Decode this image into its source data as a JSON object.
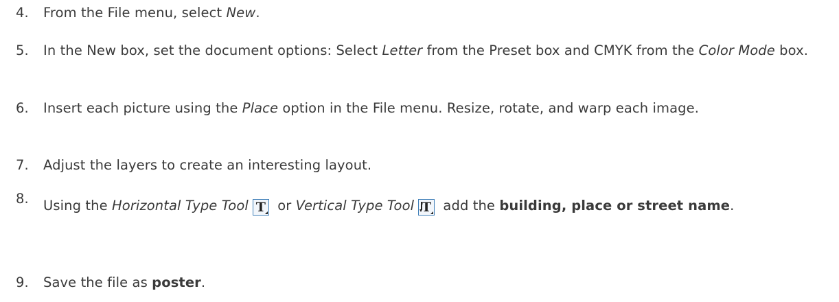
{
  "steps": [
    {
      "number": "4.",
      "parts": {
        "p1": "From the File menu, select ",
        "p2": "New",
        "p3": "."
      }
    },
    {
      "number": "5.",
      "parts": {
        "p1": "In the New box, set the document options: Select ",
        "p2": "Letter",
        "p3": " from the Preset box and CMYK from the ",
        "p4": "Color Mode",
        "p5": " box."
      }
    },
    {
      "number": "6.",
      "parts": {
        "p1": "Insert each picture using the ",
        "p2": "Place",
        "p3": " option in the File menu. Resize, rotate, and warp each image."
      }
    },
    {
      "number": "7.",
      "parts": {
        "p1": "Adjust the layers to create an interesting layout."
      }
    },
    {
      "number": "8.",
      "parts": {
        "p1": "Using the ",
        "p2": "Horizontal Type Tool",
        "p3": " or ",
        "p4": "Vertical Type Tool",
        "p5": " add the ",
        "p6": "building, place or street name",
        "p7": "."
      },
      "icons": {
        "horizontal_type_tool": {
          "glyph": "T",
          "icon": "horizontal-type-tool-icon"
        },
        "vertical_type_tool": {
          "glyph": "T",
          "icon": "vertical-type-tool-icon"
        }
      }
    },
    {
      "number": "9.",
      "parts": {
        "p1": "Save the file as ",
        "p2": "poster",
        "p3": "."
      }
    }
  ],
  "colors": {
    "text": "#3a3a3a",
    "icon_border": "#3f7fb8",
    "icon_fill": "#f2f6fb"
  }
}
